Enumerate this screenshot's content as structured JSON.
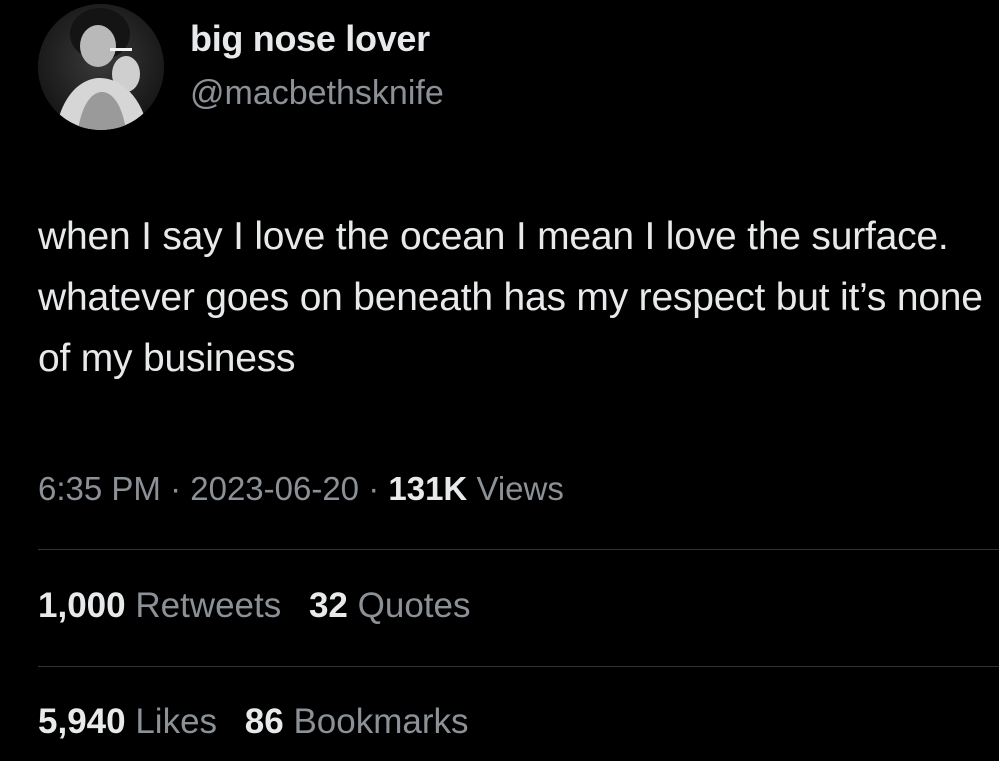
{
  "profile": {
    "display_name": "big nose lover",
    "handle": "@macbethsknife"
  },
  "tweet": {
    "text": "when I say I love the ocean I mean I love the surface. whatever goes on beneath has my respect but it’s none of my business"
  },
  "meta": {
    "time": "6:35 PM",
    "separator": " · ",
    "date": "2023-06-20",
    "views_count": "131K",
    "views_label": "Views"
  },
  "stats": {
    "retweets_count": "1,000",
    "retweets_label": "Retweets",
    "quotes_count": "32",
    "quotes_label": "Quotes",
    "likes_count": "5,940",
    "likes_label": "Likes",
    "bookmarks_count": "86",
    "bookmarks_label": "Bookmarks"
  },
  "colors": {
    "background": "#000000",
    "primary_text": "#e7e9ea",
    "secondary_text": "#8b9196",
    "divider": "#2f3336"
  }
}
